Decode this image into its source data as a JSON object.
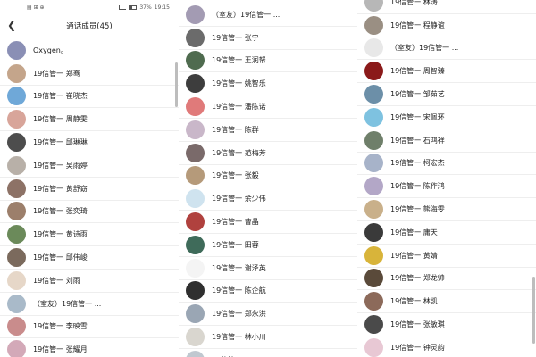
{
  "status": {
    "left": "▤ ⊞ ⊕",
    "battery": "37%",
    "time": "19:15"
  },
  "header": {
    "title": "通话成员(45)",
    "back_icon": "back-chevron-icon"
  },
  "panel1_rows": [
    {
      "name": "Oxygen。",
      "color": "#8a8fb5"
    },
    {
      "name": "19信管一 郑骞",
      "color": "#c4a58b"
    },
    {
      "name": "19信管一 崔晓杰",
      "color": "#6fa8d8"
    },
    {
      "name": "19信管一 周静雯",
      "color": "#d8a59a"
    },
    {
      "name": "19信管一 邱琳琳",
      "color": "#4d4d4d"
    },
    {
      "name": "19信管一 吴雨婷",
      "color": "#b8b0a8"
    },
    {
      "name": "19信管一 黄舒窈",
      "color": "#8d7266"
    },
    {
      "name": "19信管一 张奕琦",
      "color": "#9c7f6b"
    },
    {
      "name": "19信管一 黄诗雨",
      "color": "#6b8a5a"
    },
    {
      "name": "19信管一 邱伟峻",
      "color": "#7b6a5d"
    },
    {
      "name": "19信管一 刘雨",
      "color": "#e6d7c8"
    },
    {
      "name": "（室友）19信管一 ...",
      "color": "#a9bac9"
    },
    {
      "name": "19信管一 李映雪",
      "color": "#c98c8c"
    },
    {
      "name": "19信管一 张耀月",
      "color": "#d3a9b8"
    }
  ],
  "panel2_rows": [
    {
      "name": "（室友）19信管一 ...",
      "color": "#a39bb3"
    },
    {
      "name": "19信管一 张宁",
      "color": "#6b6b6b"
    },
    {
      "name": "19信管一 王润帑",
      "color": "#4f6b4f"
    },
    {
      "name": "19信管一 姚智乐",
      "color": "#3d3d3d"
    },
    {
      "name": "19信管一 潘陈诺",
      "color": "#e07a7a"
    },
    {
      "name": "19信管一 陈群",
      "color": "#c9b7c9"
    },
    {
      "name": "19信管一 范梅芳",
      "color": "#7a6a6a"
    },
    {
      "name": "19信管一 张毅",
      "color": "#b59a7a"
    },
    {
      "name": "19信管一 余少伟",
      "color": "#cfe3ef"
    },
    {
      "name": "19信管一 曹晶",
      "color": "#b0413e"
    },
    {
      "name": "19信管一 田蓉",
      "color": "#3f6b5a"
    },
    {
      "name": "19信管一 谢泽英",
      "color": "#f4f4f4"
    },
    {
      "name": "19信管一 陈企航",
      "color": "#2f2f2f"
    },
    {
      "name": "19信管一 郑永洪",
      "color": "#9aa6b4"
    },
    {
      "name": "19信管一 林小川",
      "color": "#d9d6cf"
    },
    {
      "name": "19信管一 ...",
      "color": "#c0c8d0"
    }
  ],
  "panel3_rows": [
    {
      "name": "19信管一 林涛",
      "color": "#b7b7b7"
    },
    {
      "name": "19信管一 程静谊",
      "color": "#9a8f83"
    },
    {
      "name": "（室友）19信管一 ...",
      "color": "#e8e8e8"
    },
    {
      "name": "19信管一 周智臻",
      "color": "#8b1a1a"
    },
    {
      "name": "19信管一 邹茹艺",
      "color": "#6c8fa8"
    },
    {
      "name": "19信管一 宋佩环",
      "color": "#7ec2e0"
    },
    {
      "name": "19信管一 石鸿祥",
      "color": "#6f7f6a"
    },
    {
      "name": "19信管一 柯宏杰",
      "color": "#a7b3c9"
    },
    {
      "name": "19信管一 陈作鸿",
      "color": "#b3a7c7"
    },
    {
      "name": "19信管一 熊海雯",
      "color": "#c9b08a"
    },
    {
      "name": "19信管一 庸天",
      "color": "#3a3a3a"
    },
    {
      "name": "19信管一 黄婧",
      "color": "#d8b43a"
    },
    {
      "name": "19信管一 郑龙帅",
      "color": "#5a4a3a"
    },
    {
      "name": "19信管一 林凯",
      "color": "#8c6a5a"
    },
    {
      "name": "19信管一 张敏琪",
      "color": "#4a4a4a"
    },
    {
      "name": "19信管一 钟灵韵",
      "color": "#e8c8d4"
    }
  ]
}
